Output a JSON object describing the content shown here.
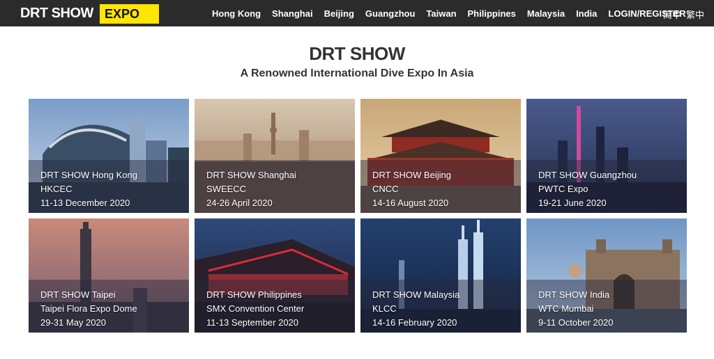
{
  "brand": {
    "name": "DRT SHOW",
    "badge": "EXPO"
  },
  "nav": {
    "links": [
      "Hong Kong",
      "Shanghai",
      "Beijing",
      "Guangzhou",
      "Taiwan",
      "Philippines",
      "Malaysia",
      "India",
      "LOGIN/REGISTER"
    ],
    "lang_simplified": "简中",
    "lang_traditional": "繁中"
  },
  "header": {
    "title": "DRT SHOW",
    "subtitle": "A Renowned International Dive Expo In Asia"
  },
  "cards": [
    {
      "name": "DRT SHOW Hong Kong",
      "venue": "HKCEC",
      "dates": "11-13 December 2020"
    },
    {
      "name": "DRT SHOW Shanghai",
      "venue": "SWEECC",
      "dates": "24-26 April 2020"
    },
    {
      "name": "DRT SHOW Beijing",
      "venue": "CNCC",
      "dates": "14-16 August 2020"
    },
    {
      "name": "DRT SHOW Guangzhou",
      "venue": "PWTC Expo",
      "dates": "19-21 June 2020"
    },
    {
      "name": "DRT SHOW Taipei",
      "venue": "Taipei Flora Expo Dome",
      "dates": "29-31 May 2020"
    },
    {
      "name": "DRT SHOW Philippines",
      "venue": "SMX Convention Center",
      "dates": "11-13 September 2020"
    },
    {
      "name": "DRT SHOW Malaysia",
      "venue": "KLCC",
      "dates": "14-16 February 2020"
    },
    {
      "name": "DRT SHOW India",
      "venue": "WTC Mumbai",
      "dates": "9-11 October 2020"
    }
  ],
  "colors": {
    "navbar": "#2b2b2b",
    "badge": "#ffe600",
    "title": "#333333"
  }
}
